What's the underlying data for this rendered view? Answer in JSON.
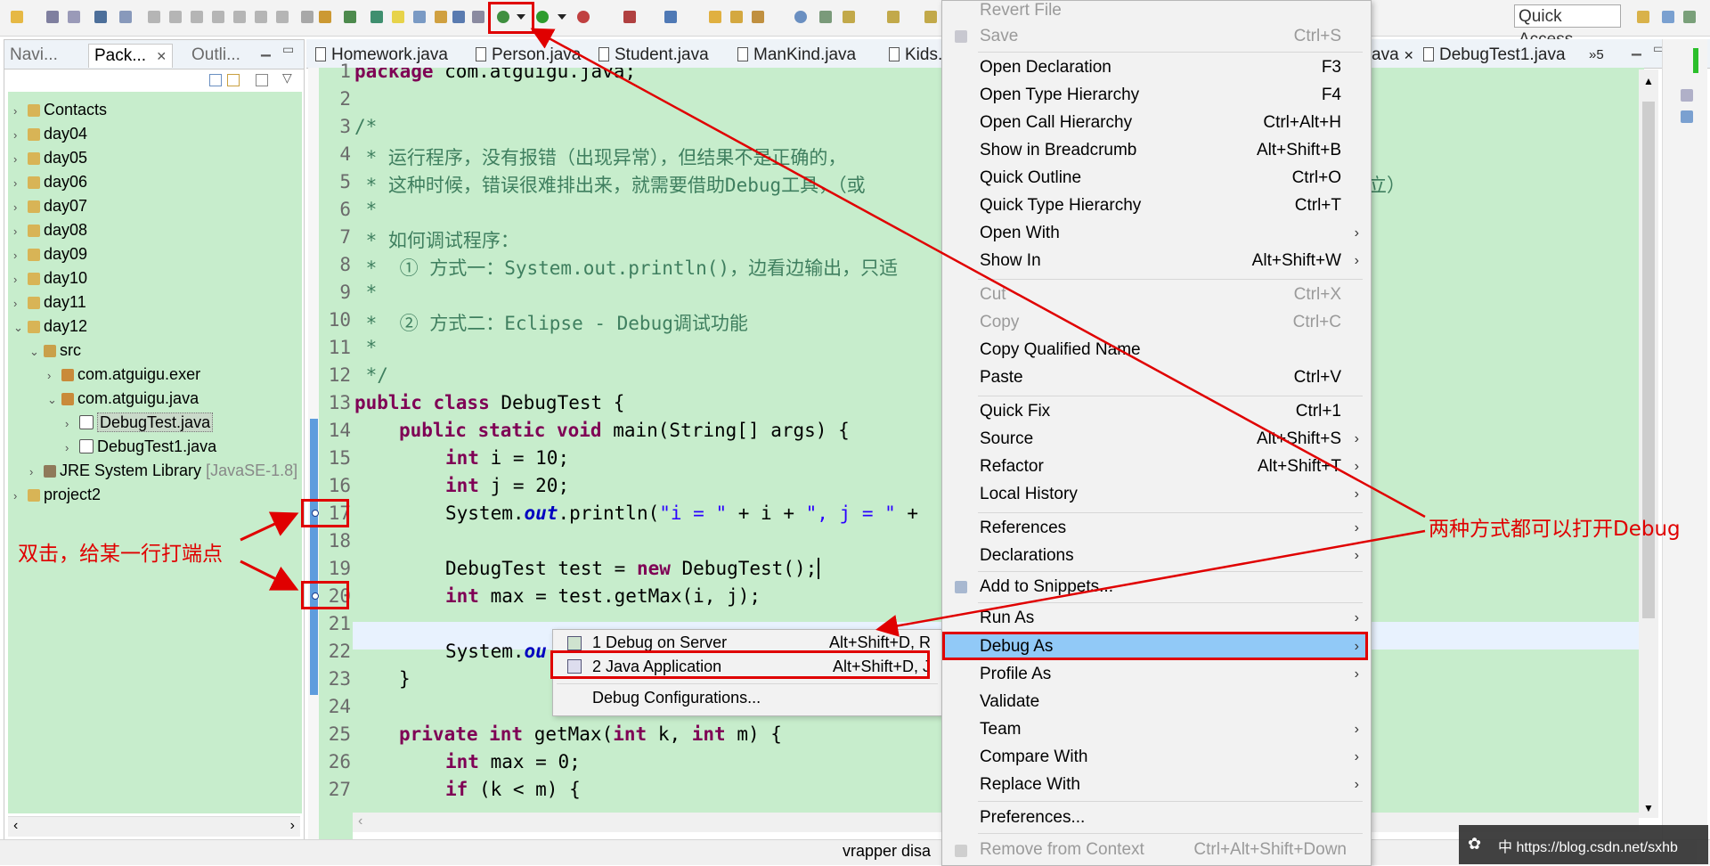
{
  "toolbar": {
    "quick_access": "Quick Access"
  },
  "left_view": {
    "tabs": [
      "Navi...",
      "Pack...",
      "Outli..."
    ],
    "tree": [
      {
        "label": "Contacts"
      },
      {
        "label": "day04"
      },
      {
        "label": "day05"
      },
      {
        "label": "day06"
      },
      {
        "label": "day07"
      },
      {
        "label": "day08"
      },
      {
        "label": "day09"
      },
      {
        "label": "day10"
      },
      {
        "label": "day11"
      },
      {
        "label": "day12"
      },
      {
        "label": "src"
      },
      {
        "label": "com.atguigu.exer"
      },
      {
        "label": "com.atguigu.java"
      },
      {
        "label": "DebugTest.java"
      },
      {
        "label": "DebugTest1.java"
      },
      {
        "label": "JRE System Library",
        "extra": "[JavaSE-1.8]"
      },
      {
        "label": "project2"
      }
    ]
  },
  "editor": {
    "tabs": [
      "Homework.java",
      "Person.java",
      "Student.java",
      "ManKind.java",
      "Kids.j",
      "ava",
      "DebugTest1.java"
    ],
    "tab_overflow": "»5",
    "line_numbers": [
      "1",
      "2",
      "3",
      "4",
      "5",
      "6",
      "7",
      "8",
      "9",
      "10",
      "11",
      "12",
      "13",
      "14",
      "15",
      "16",
      "17",
      "18",
      "19",
      "20",
      "21",
      "22",
      "23",
      "24",
      "25",
      "26",
      "27"
    ],
    "lines": {
      "l1_kw": "package",
      "l1_rest": " com.atguigu.java;",
      "l3": "/*",
      "l4": " * 运行程序，没有报错（出现异常），但结果不是正确的，",
      "l5a": " * 这种时候，错误很难排出来，就需要借助Debug工具，（或",
      "l5b": "立）",
      "l6": " *",
      "l7": " * 如何调试程序：",
      "l8": " *  ① 方式一：System.out.println()，边看边输出，只适",
      "l9": " *",
      "l10": " *  ② 方式二：Eclipse - Debug调试功能",
      "l11": " *",
      "l12": " */",
      "l13_kw": "public class",
      "l13_rest": " DebugTest {",
      "l14_kw": "public static void",
      "l14_rest": " main(String[] args) {",
      "l15_kw": "int",
      "l15_rest": " i = 10;",
      "l16_kw": "int",
      "l16_rest": " j = 20;",
      "l17_a": "System.",
      "l17_out": "out",
      "l17_b": ".println(",
      "l17_s1": "\"i = \"",
      "l17_c": " + i + ",
      "l17_s2": "\", j = \"",
      "l17_d": " +",
      "l19_a": "DebugTest test = ",
      "l19_kw": "new",
      "l19_b": " DebugTest();",
      "l20_kw": "int",
      "l20_rest": " max = test.getMax(i, j);",
      "l22_a": "System.",
      "l22_out": "ou",
      "l23": "}",
      "l25_kw1": "private int",
      "l25_a": " getMax(",
      "l25_kw2": "int",
      "l25_b": " k, ",
      "l25_kw3": "int",
      "l25_c": " m) {",
      "l26_kw": "int",
      "l26_rest": " max = 0;",
      "l27_kw": "if",
      "l27_rest": " (k < m) {"
    }
  },
  "status_bar": {
    "text": "vrapper disa"
  },
  "context_menu": {
    "items": [
      {
        "label": "Revert File",
        "shortcut": "",
        "disabled": true
      },
      {
        "label": "Save",
        "shortcut": "Ctrl+S",
        "disabled": true
      },
      {
        "label": "Open Declaration",
        "shortcut": "F3"
      },
      {
        "label": "Open Type Hierarchy",
        "shortcut": "F4"
      },
      {
        "label": "Open Call Hierarchy",
        "shortcut": "Ctrl+Alt+H"
      },
      {
        "label": "Show in Breadcrumb",
        "shortcut": "Alt+Shift+B"
      },
      {
        "label": "Quick Outline",
        "shortcut": "Ctrl+O"
      },
      {
        "label": "Quick Type Hierarchy",
        "shortcut": "Ctrl+T"
      },
      {
        "label": "Open With",
        "shortcut": ""
      },
      {
        "label": "Show In",
        "shortcut": "Alt+Shift+W"
      },
      {
        "label": "Cut",
        "shortcut": "Ctrl+X",
        "disabled": true
      },
      {
        "label": "Copy",
        "shortcut": "Ctrl+C",
        "disabled": true
      },
      {
        "label": "Copy Qualified Name",
        "shortcut": ""
      },
      {
        "label": "Paste",
        "shortcut": "Ctrl+V"
      },
      {
        "label": "Quick Fix",
        "shortcut": "Ctrl+1"
      },
      {
        "label": "Source",
        "shortcut": "Alt+Shift+S"
      },
      {
        "label": "Refactor",
        "shortcut": "Alt+Shift+T"
      },
      {
        "label": "Local History",
        "shortcut": ""
      },
      {
        "label": "References",
        "shortcut": ""
      },
      {
        "label": "Declarations",
        "shortcut": ""
      },
      {
        "label": "Add to Snippets...",
        "shortcut": ""
      },
      {
        "label": "Run As",
        "shortcut": ""
      },
      {
        "label": "Debug As",
        "shortcut": ""
      },
      {
        "label": "Profile As",
        "shortcut": ""
      },
      {
        "label": "Validate",
        "shortcut": ""
      },
      {
        "label": "Team",
        "shortcut": ""
      },
      {
        "label": "Compare With",
        "shortcut": ""
      },
      {
        "label": "Replace With",
        "shortcut": ""
      },
      {
        "label": "Preferences...",
        "shortcut": ""
      },
      {
        "label": "Remove from Context",
        "shortcut": "Ctrl+Alt+Shift+Down",
        "disabled": true
      }
    ]
  },
  "debug_submenu": {
    "items": [
      {
        "label": "1 Debug on Server",
        "shortcut": "Alt+Shift+D, R"
      },
      {
        "label": "2 Java Application",
        "shortcut": "Alt+Shift+D, J"
      },
      {
        "label": "Debug Configurations...",
        "shortcut": ""
      }
    ]
  },
  "annotations": {
    "left": "双击，给某一行打端点",
    "right": "两种方式都可以打开Debug",
    "color": "#e00000"
  },
  "watermark": {
    "text": "中 https://blog.csdn.net/sxhb"
  }
}
